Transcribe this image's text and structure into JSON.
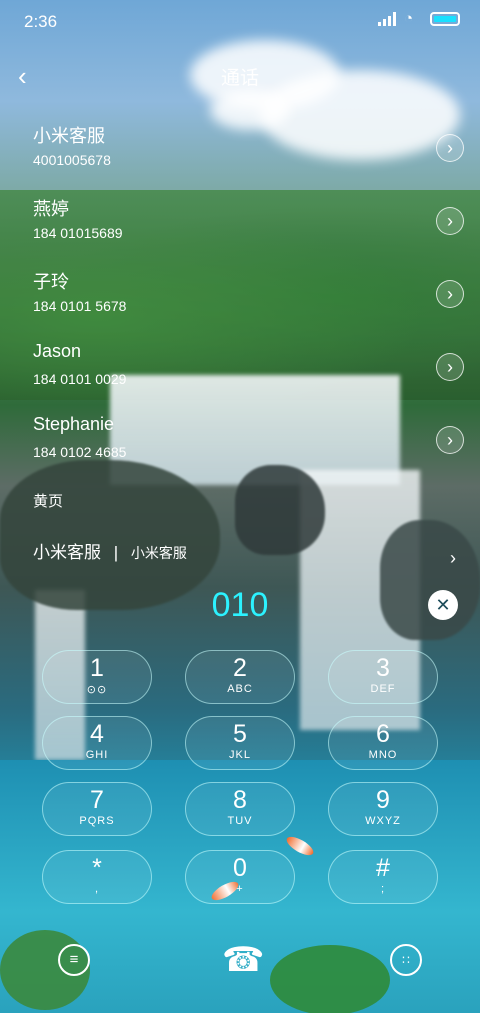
{
  "status_bar": {
    "time": "2:36"
  },
  "header": {
    "title": "通话"
  },
  "calls": [
    {
      "name": "小米客服",
      "number": "4001005678"
    },
    {
      "name": "燕婷",
      "number": "184 01015689"
    },
    {
      "name": "子玲",
      "number": "184 0101 5678"
    },
    {
      "name": "Jason",
      "number": "184 0101 0029"
    },
    {
      "name": "Stephanie",
      "number": "184 0102 4685"
    }
  ],
  "section": {
    "label": "黄页"
  },
  "match": {
    "name": "小米客服",
    "separator": "|",
    "subtitle": "小米客服"
  },
  "dialer": {
    "number": "010",
    "keys": [
      {
        "digit": "1",
        "letters": ""
      },
      {
        "digit": "2",
        "letters": "ABC"
      },
      {
        "digit": "3",
        "letters": "DEF"
      },
      {
        "digit": "4",
        "letters": "GHI"
      },
      {
        "digit": "5",
        "letters": "JKL"
      },
      {
        "digit": "6",
        "letters": "MNO"
      },
      {
        "digit": "7",
        "letters": "PQRS"
      },
      {
        "digit": "8",
        "letters": "TUV"
      },
      {
        "digit": "9",
        "letters": "WXYZ"
      },
      {
        "digit": "*",
        "letters": ","
      },
      {
        "digit": "0",
        "letters": "+"
      },
      {
        "digit": "#",
        "letters": ";"
      }
    ]
  },
  "icons": {
    "back": "chevron-left-icon",
    "row_action": "chevron-right-icon",
    "delete": "backspace-icon",
    "voicemail": "voicemail-icon",
    "menu": "menu-icon",
    "call": "phone-icon",
    "keypad_toggle": "dialpad-icon"
  },
  "colors": {
    "accent": "#2cf2ff",
    "battery": "#19e0ff"
  }
}
